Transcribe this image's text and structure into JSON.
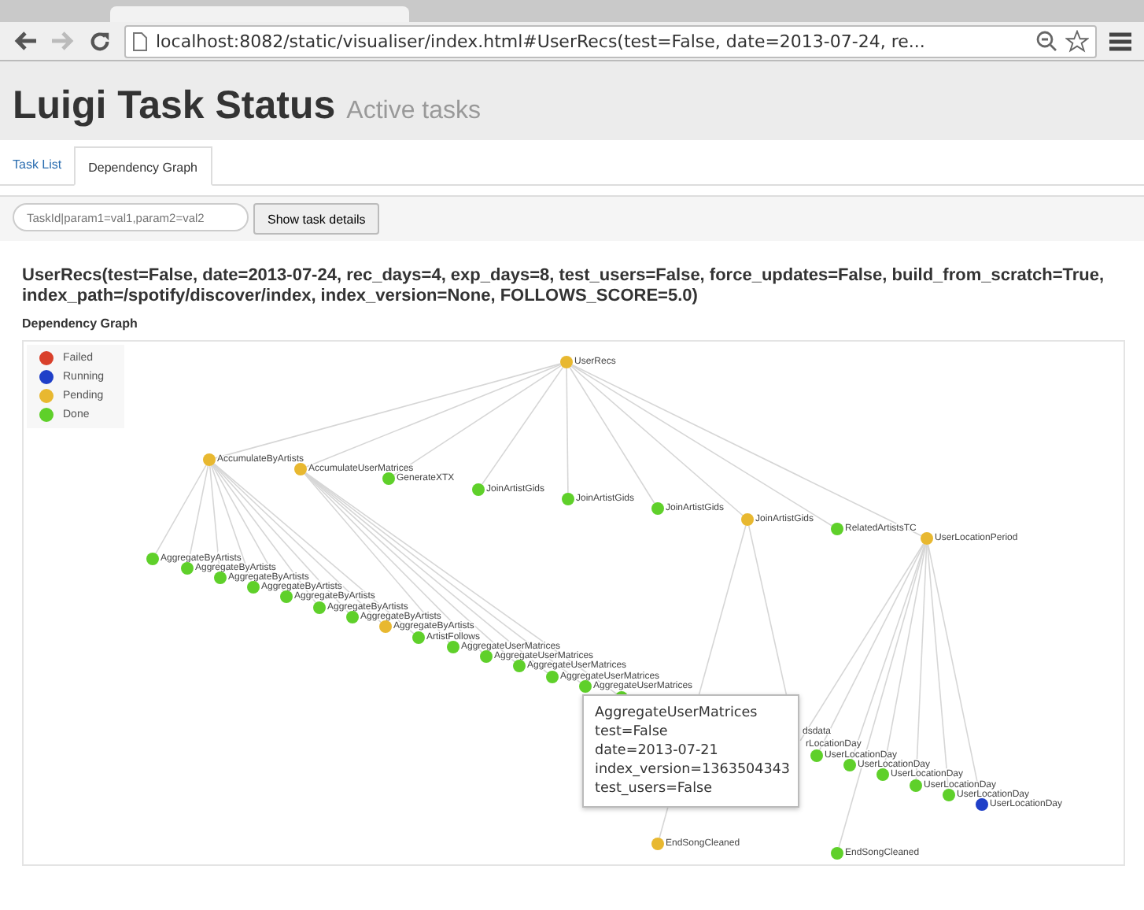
{
  "browser": {
    "url": "localhost:8082/static/visualiser/index.html#UserRecs(test=False, date=2013-07-24, re..."
  },
  "header": {
    "title": "Luigi Task Status",
    "subtitle": "Active tasks"
  },
  "tabs": [
    {
      "label": "Task List",
      "selected": false
    },
    {
      "label": "Dependency Graph",
      "selected": true
    }
  ],
  "search": {
    "placeholder": "TaskId|param1=val1,param2=val2",
    "button": "Show task details"
  },
  "task_title": "UserRecs(test=False, date=2013-07-24, rec_days=4, exp_days=8, test_users=False, force_updates=False, build_from_scratch=True, index_path=/spotify/discover/index, index_version=None, FOLLOWS_SCORE=5.0)",
  "graph_label": "Dependency Graph",
  "legend": [
    {
      "label": "Failed",
      "color": "#d9402b"
    },
    {
      "label": "Running",
      "color": "#1f3fc8"
    },
    {
      "label": "Pending",
      "color": "#e8b830"
    },
    {
      "label": "Done",
      "color": "#5fd02a"
    }
  ],
  "graph": {
    "label": "UserRecs",
    "kind": "pending",
    "children": [
      {
        "label": "AccumulateByArtists",
        "kind": "pending",
        "children": [
          {
            "label": "AggregateByArtists",
            "kind": "done"
          },
          {
            "label": "AggregateByArtists",
            "kind": "done"
          },
          {
            "label": "AggregateByArtists",
            "kind": "done"
          },
          {
            "label": "AggregateByArtists",
            "kind": "done"
          },
          {
            "label": "AggregateByArtists",
            "kind": "done"
          },
          {
            "label": "AggregateByArtists",
            "kind": "done"
          },
          {
            "label": "AggregateByArtists",
            "kind": "done"
          },
          {
            "label": "AggregateByArtists",
            "kind": "pending"
          },
          {
            "label": "ArtistFollows",
            "kind": "done"
          }
        ]
      },
      {
        "label": "AccumulateUserMatrices",
        "kind": "pending",
        "children": [
          {
            "label": "AggregateUserMatrices",
            "kind": "done"
          },
          {
            "label": "AggregateUserMatrices",
            "kind": "done"
          },
          {
            "label": "AggregateUserMatrices",
            "kind": "done"
          },
          {
            "label": "AggregateUserMatrices",
            "kind": "done"
          },
          {
            "label": "AggregateUserMatrices",
            "kind": "done"
          },
          {
            "kind": "done"
          }
        ]
      },
      {
        "label": "GenerateXTX",
        "kind": "done"
      },
      {
        "label": "JoinArtistGids",
        "kind": "done"
      },
      {
        "label": "JoinArtistGids",
        "kind": "done"
      },
      {
        "label": "JoinArtistGids",
        "kind": "done"
      },
      {
        "label": "JoinArtistGids",
        "kind": "pending",
        "children": [
          {
            "label": "dsdata"
          },
          {
            "label": "EndSongCleaned",
            "kind": "pending"
          }
        ]
      },
      {
        "label": "RelatedArtistsTC",
        "kind": "done"
      },
      {
        "label": "UserLocationPeriod",
        "kind": "pending",
        "children": [
          {
            "label": "rLocationDay"
          },
          {
            "label": "UserLocationDay",
            "kind": "done"
          },
          {
            "label": "UserLocationDay",
            "kind": "done"
          },
          {
            "label": "UserLocationDay",
            "kind": "done"
          },
          {
            "label": "UserLocationDay",
            "kind": "done"
          },
          {
            "label": "UserLocationDay",
            "kind": "done"
          },
          {
            "label": "UserLocationDay",
            "kind": "running"
          },
          {
            "label": "EndSongCleaned",
            "kind": "done"
          }
        ]
      }
    ]
  },
  "tooltip": [
    "AggregateUserMatrices",
    "test=False",
    "date=2013-07-21",
    "index_version=1363504343",
    "test_users=False"
  ]
}
